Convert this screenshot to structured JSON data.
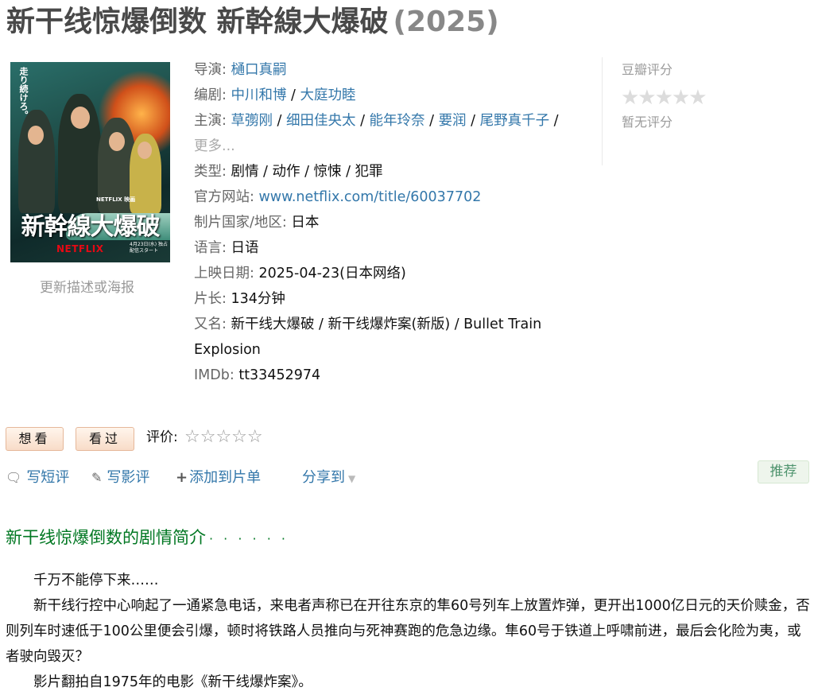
{
  "title": {
    "name": "新干线惊爆倒数 新幹線大爆破",
    "year": "(2025)"
  },
  "poster": {
    "title_text": "新幹線大爆破",
    "brand": "NETFLIX",
    "top_brand": "NETFLIX 映画",
    "side_text": "走り続けろ。",
    "date_text": "4月23日(水) 独占配信スタート"
  },
  "update_link": "更新描述或海报",
  "info": {
    "director_label": "导演",
    "directors": [
      "樋口真嗣"
    ],
    "writer_label": "编剧",
    "writers": [
      "中川和博",
      "大庭功睦"
    ],
    "cast_label": "主演",
    "cast": [
      "草彅刚",
      "细田佳央太",
      "能年玲奈",
      "要润",
      "尾野真千子"
    ],
    "cast_more": "更多...",
    "genre_label": "类型:",
    "genres": "剧情 / 动作 / 惊悚 / 犯罪",
    "website_label": "官方网站:",
    "website": "www.netflix.com/title/60037702",
    "country_label": "制片国家/地区:",
    "country": "日本",
    "language_label": "语言:",
    "language": "日语",
    "release_label": "上映日期:",
    "release": "2025-04-23(日本网络)",
    "runtime_label": "片长:",
    "runtime": "134分钟",
    "aka_label": "又名:",
    "aka": "新干线大爆破 / 新干线爆炸案(新版) / Bullet Train Explosion",
    "imdb_label": "IMDb:",
    "imdb": "tt33452974"
  },
  "rating": {
    "label": "豆瓣评分",
    "stars": "★★★★★",
    "empty_text": "暂无评分"
  },
  "buttons": {
    "want": "想看",
    "seen": "看过"
  },
  "rate": {
    "label": "评价:",
    "stars": "☆☆☆☆☆"
  },
  "actions": {
    "short_review": "写短评",
    "review": "写影评",
    "add_list": "添加到片单",
    "share": "分享到"
  },
  "recommend": "推荐",
  "section": {
    "title": "新干线惊爆倒数的剧情简介",
    "dots": "· · · · · ·"
  },
  "synopsis": [
    "千万不能停下来……",
    "新干线行控中心响起了一通紧急电话，来电者声称已在开往东京的隼60号列车上放置炸弹，更开出1000亿日元的天价赎金，否则列车时速低于100公里便会引爆，顿时将铁路人员推向与死神赛跑的危急边缘。隼60号于铁道上呼啸前进，最后会化险为夷，或者驶向毁灭？",
    "影片翻拍自1975年的电影《新干线爆炸案》。"
  ]
}
